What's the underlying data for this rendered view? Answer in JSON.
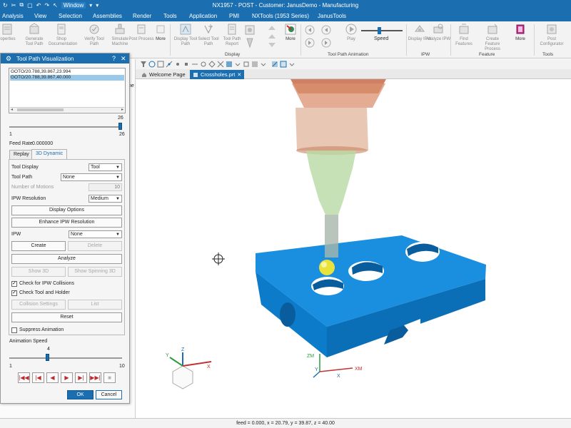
{
  "app": {
    "title": "NX1957 - POST - Customer: JanusDemo - Manufacturing",
    "window_menu": "Window"
  },
  "menu": [
    "Analysis",
    "View",
    "Selection",
    "Assemblies",
    "Render",
    "Tools",
    "Application",
    "PMI",
    "NXTools (1953 Series)",
    "JanusTools"
  ],
  "ribbon": {
    "buttons": [
      {
        "label": "roperties",
        "icon": "properties-icon"
      },
      {
        "label": "Generate Tool Path",
        "icon": "generate-tool-path-icon"
      },
      {
        "label": "Shop Documentation",
        "icon": "shop-documentation-icon"
      },
      {
        "label": "Verify Tool Path",
        "icon": "verify-tool-path-icon"
      },
      {
        "label": "Simulate Machine",
        "icon": "simulate-machine-icon"
      },
      {
        "label": "Post Process",
        "icon": "post-process-icon"
      },
      {
        "label": "More",
        "icon": "more-icon"
      },
      {
        "label": "Display Tool Path",
        "icon": "display-tool-path-icon"
      },
      {
        "label": "Select Tool Path",
        "icon": "select-tool-path-icon"
      },
      {
        "label": "Tool Path Report",
        "icon": "tool-path-report-icon"
      },
      {
        "label": "More",
        "icon": "more-icon"
      },
      {
        "label": "Play",
        "icon": "play-icon"
      },
      {
        "label": "Speed",
        "icon": "speed-slider-icon"
      },
      {
        "label": "Display IPW",
        "icon": "display-ipw-icon"
      },
      {
        "label": "Analyze IPW",
        "icon": "analyze-ipw-icon"
      },
      {
        "label": "Find Features",
        "icon": "find-features-icon"
      },
      {
        "label": "Create Feature Process",
        "icon": "create-feature-process-icon"
      },
      {
        "label": "More",
        "icon": "more-icon"
      },
      {
        "label": "Post Configurator",
        "icon": "post-configurator-icon"
      }
    ],
    "groups": [
      "Display",
      "Tool Path Animation",
      "IPW",
      "Feature",
      "Tools"
    ]
  },
  "doc_tabs": [
    {
      "label": "Welcome Page",
      "active": false
    },
    {
      "label": "Crossholes.prt",
      "active": true
    }
  ],
  "dialog": {
    "title": "Tool Path Visualization",
    "motions": [
      "GOTO/20.788,39.867,23.994",
      "GOTO/20.788,39.867,40.000"
    ],
    "selected_motion": 1,
    "motion_slider": {
      "value": "26",
      "min": "1",
      "max": "26",
      "fraction": 1.0
    },
    "feed_rate_label": "Feed Rate",
    "feed_rate_value": "0.000000",
    "tabs": [
      "Replay",
      "3D Dynamic"
    ],
    "active_tab": "3D Dynamic",
    "tool_display_label": "Tool Display",
    "tool_display_value": "Tool",
    "tool_path_label": "Tool Path",
    "tool_path_value": "None",
    "number_of_motions_label": "Number of Motions",
    "number_of_motions_value": "10",
    "ipw_resolution_label": "IPW Resolution",
    "ipw_resolution_value": "Medium",
    "display_options": "Display Options",
    "enhance_ipw": "Enhance IPW Resolution",
    "ipw_label": "IPW",
    "ipw_value": "None",
    "create": "Create",
    "delete": "Delete",
    "analyze": "Analyze",
    "show_3d": "Show 3D",
    "show_spinning_3d": "Show Spinning 3D",
    "check_ipw_collisions": "Check for IPW Collisions",
    "check_tool_holder": "Check Tool and Holder",
    "collision_settings": "Collision Settings",
    "list": "List",
    "reset": "Reset",
    "suppress_animation": "Suppress Animation",
    "animation_speed_label": "Animation Speed",
    "animation_speed": {
      "value": "4",
      "min": "1",
      "max": "10",
      "fraction": 0.333
    },
    "ok": "OK",
    "cancel": "Cancel"
  },
  "status": "feed = 0.000, x = 20.79, y = 39.87, z = 40.00",
  "axis_labels": {
    "x": "X",
    "y": "Y",
    "z": "Z",
    "xm": "XM",
    "zm": "ZM"
  },
  "colors": {
    "title_blue": "#1b6fb0",
    "part_blue": "#1a8fe0",
    "tool_green": "#b8d9a2",
    "holder_orange": "#d9906f",
    "ball_yellow": "#e9e23a"
  }
}
